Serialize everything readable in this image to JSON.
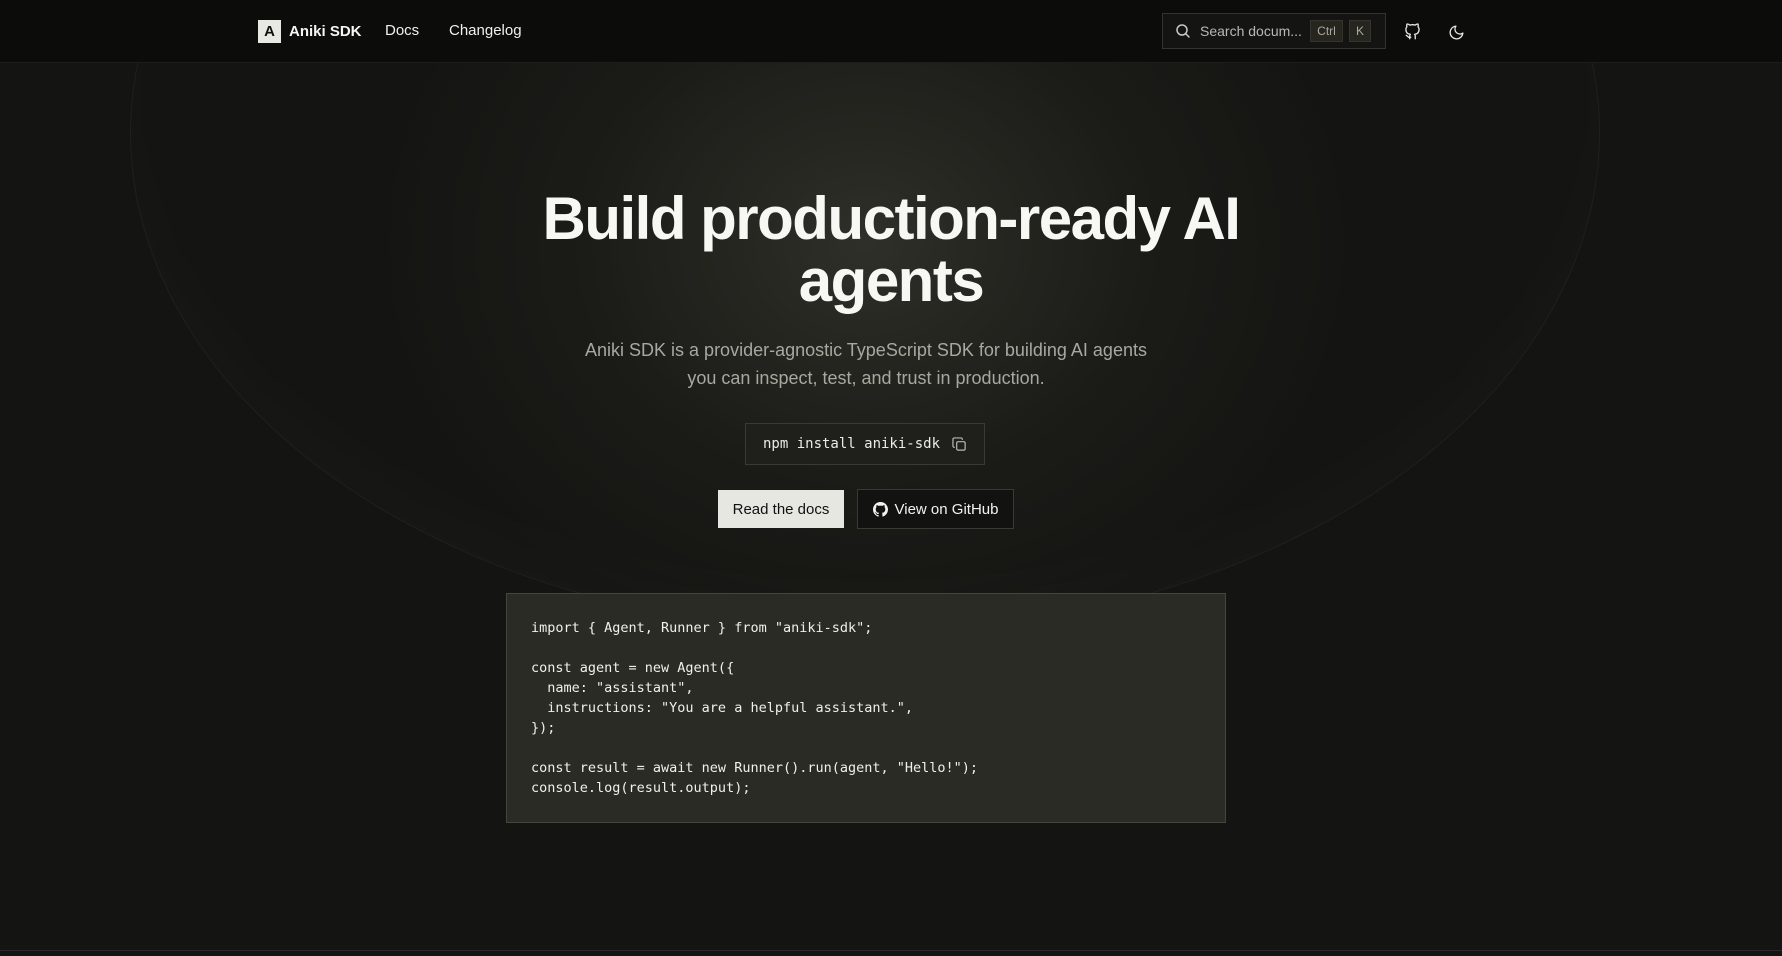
{
  "nav": {
    "brand_mark": "A",
    "brand_name": "Aniki SDK",
    "links": [
      "Docs",
      "Changelog"
    ],
    "search_placeholder": "Search docum...",
    "search_shortcut": [
      "Ctrl",
      "K"
    ],
    "icons": [
      "search-icon",
      "github-icon",
      "moon-icon"
    ]
  },
  "hero": {
    "headline_line1": "Build production-ready AI",
    "headline_line2": "agents",
    "subhead_line1": "Aniki SDK is a provider-agnostic TypeScript SDK for building AI agents",
    "subhead_line2": "you can inspect, test, and trust in production.",
    "install_command": "npm install aniki-sdk",
    "primary_cta": "Read the docs",
    "secondary_cta": "View on GitHub"
  },
  "code_sample": {
    "lines": [
      "import { Agent, Runner } from \"aniki-sdk\";",
      "",
      "const agent = new Agent({",
      "  name: \"assistant\",",
      "  instructions: \"You are a helpful assistant.\",",
      "});",
      "",
      "const result = await new Runner().run(agent, \"Hello!\");",
      "console.log(result.output);"
    ]
  },
  "colors": {
    "background": "#121210",
    "primary_button": "#e7e7e2",
    "code_background": "#2b2b25"
  }
}
